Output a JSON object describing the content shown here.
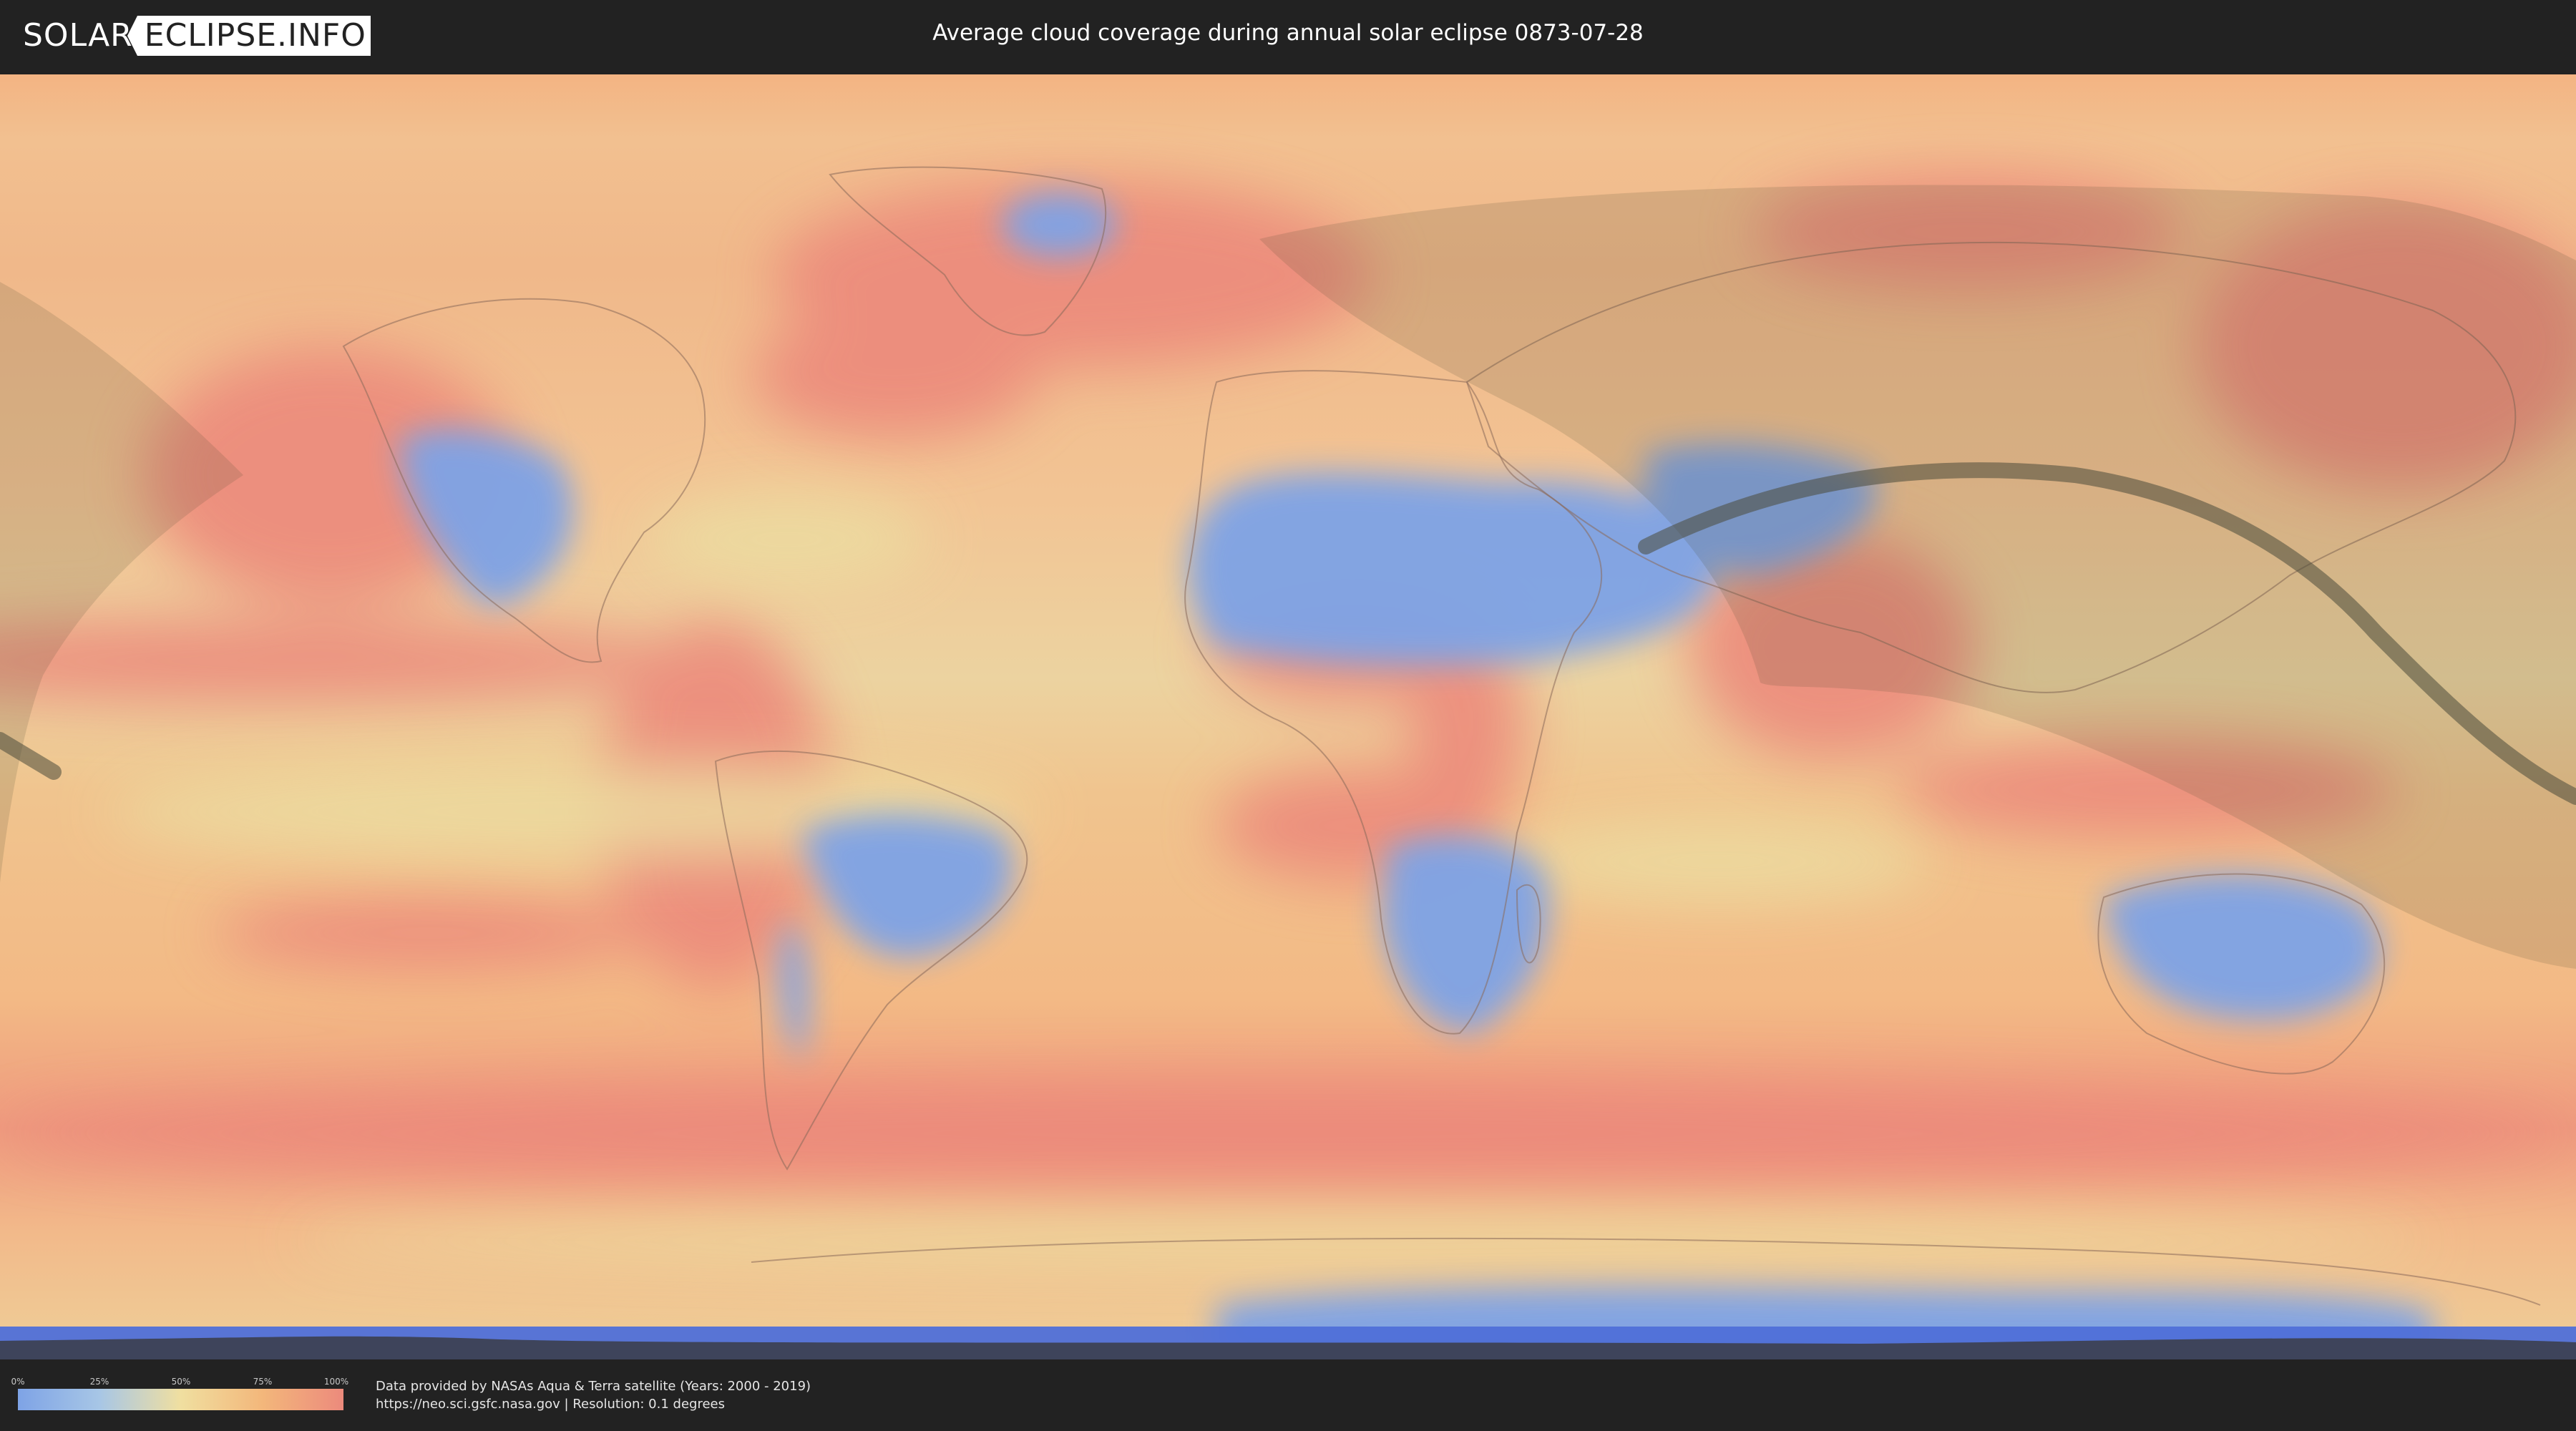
{
  "header": {
    "logo_left": "SOLAR",
    "logo_right": "ECLIPSE.INFO",
    "title": "Average cloud coverage during annual solar eclipse 0873-07-28"
  },
  "map": {
    "layer": "average cloud coverage",
    "projection": "equirectangular",
    "colors": {
      "clear": "#7ea3e6",
      "low": "#a7c6e6",
      "mid": "#ecdca0",
      "high": "#f3b77b",
      "overcast": "#ec8a7c",
      "ice": "#4f6fd8",
      "eclipse_shadow": "#4a4a30"
    }
  },
  "legend": {
    "ticks": [
      "0%",
      "25%",
      "50%",
      "75%",
      "100%"
    ],
    "colors": [
      "#7ea3e6",
      "#a7c6e6",
      "#f0dfa0",
      "#f3b77b",
      "#ec8a7c"
    ]
  },
  "footer": {
    "credit_line1": "Data provided by NASAs Aqua & Terra satellite (Years: 2000 - 2019)",
    "credit_line2": "https://neo.sci.gsfc.nasa.gov | Resolution: 0.1 degrees"
  }
}
